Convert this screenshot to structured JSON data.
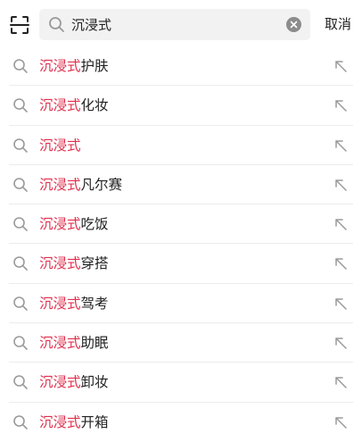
{
  "search": {
    "query": "沉浸式",
    "cancel_label": "取消"
  },
  "colors": {
    "highlight": "#e0304e",
    "search_bg": "#f2f2f2"
  },
  "icons": {
    "scan": "scan-icon",
    "search": "search-icon",
    "clear": "clear-icon",
    "fill": "arrow-up-left-icon"
  },
  "suggestions": [
    {
      "highlight": "沉浸式",
      "rest": "护肤"
    },
    {
      "highlight": "沉浸式",
      "rest": "化妆"
    },
    {
      "highlight": "沉浸式",
      "rest": ""
    },
    {
      "highlight": "沉浸式",
      "rest": "凡尔赛"
    },
    {
      "highlight": "沉浸式",
      "rest": "吃饭"
    },
    {
      "highlight": "沉浸式",
      "rest": "穿搭"
    },
    {
      "highlight": "沉浸式",
      "rest": "驾考"
    },
    {
      "highlight": "沉浸式",
      "rest": "助眠"
    },
    {
      "highlight": "沉浸式",
      "rest": "卸妆"
    },
    {
      "highlight": "沉浸式",
      "rest": "开箱"
    }
  ]
}
